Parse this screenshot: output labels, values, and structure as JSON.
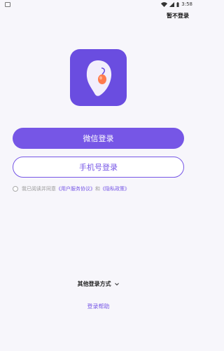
{
  "status_bar": {
    "time": "3:58"
  },
  "header": {
    "skip_label": "暂不登录"
  },
  "buttons": {
    "wechat_login": "微信登录",
    "phone_login": "手机号登录"
  },
  "agreement": {
    "prefix": "我已阅读并同意",
    "user_agreement": "《用户服务协议》",
    "and": "和",
    "privacy_policy": "《隐私政策》"
  },
  "other_login": {
    "label": "其他登录方式"
  },
  "help": {
    "label": "登录帮助"
  },
  "colors": {
    "accent": "#7656e6",
    "logo_bg": "#6a4de0",
    "background": "#f7f6fb"
  },
  "icons": [
    "settings-icon",
    "wifi-icon",
    "signal-icon",
    "battery-icon",
    "app-logo-icon",
    "chevron-down-icon"
  ]
}
